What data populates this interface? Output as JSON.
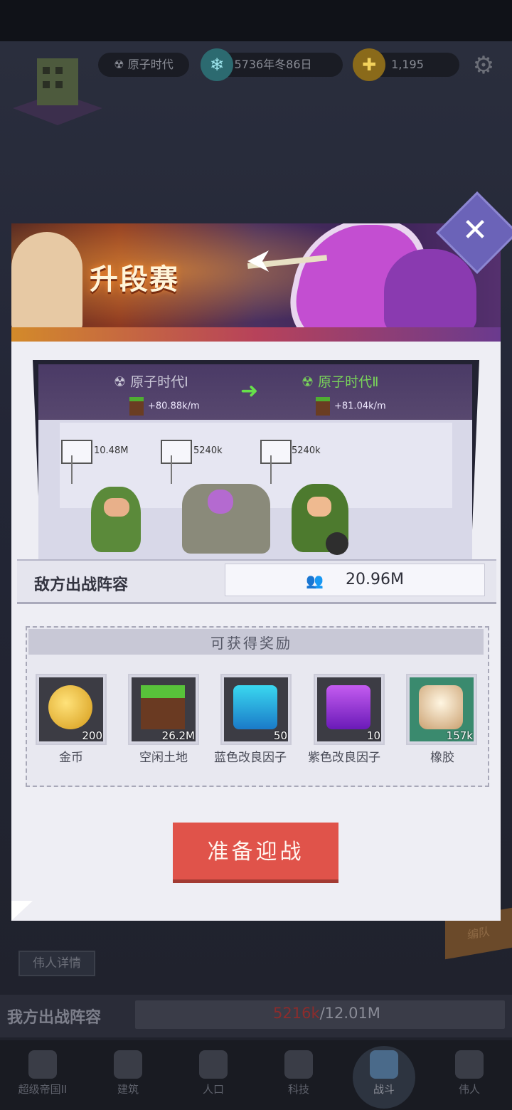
{
  "top_bar": {
    "age_label": "原子时代",
    "time_label": "5736年冬86日",
    "gold_label": "1,195",
    "icons": [
      "castle-icon",
      "radiation-icon",
      "snowflake-icon",
      "coin-plus-icon",
      "gear-icon"
    ]
  },
  "dialog": {
    "banner_title": "升段赛",
    "age_from": "原子时代Ⅰ",
    "age_to": "原子时代Ⅱ",
    "rate_from": "+80.88k/m",
    "rate_to": "+81.04k/m",
    "enemy_units": [
      {
        "power": "10.48M"
      },
      {
        "power": "5240k"
      },
      {
        "power": "5240k"
      }
    ],
    "enemy_lineup_label": "敌方出战阵容",
    "enemy_total_power": "20.96M",
    "rewards_title": "可获得奖励",
    "rewards": [
      {
        "name": "金币",
        "count": "200"
      },
      {
        "name": "空闲土地",
        "count": "26.2M"
      },
      {
        "name": "蓝色改良因子",
        "count": "50"
      },
      {
        "name": "紫色改良因子",
        "count": "10"
      },
      {
        "name": "橡胶",
        "count": "157k"
      }
    ],
    "ready_button": "准备迎战",
    "close_label": "✕"
  },
  "background": {
    "detail_button": "伟人详情",
    "right_tag": "编队",
    "my_lineup_label": "我方出战阵容",
    "my_power_current": "5216k",
    "my_power_max": "/12.01M"
  },
  "bottom_nav": [
    {
      "label": "超级帝国II"
    },
    {
      "label": "建筑"
    },
    {
      "label": "人口"
    },
    {
      "label": "科技"
    },
    {
      "label": "战斗"
    },
    {
      "label": "伟人"
    }
  ],
  "colors": {
    "accent_green": "#79d35a",
    "ready_button": "#e0534a",
    "close_button": "#6b63b8",
    "my_power_red": "#8c2c2c"
  }
}
